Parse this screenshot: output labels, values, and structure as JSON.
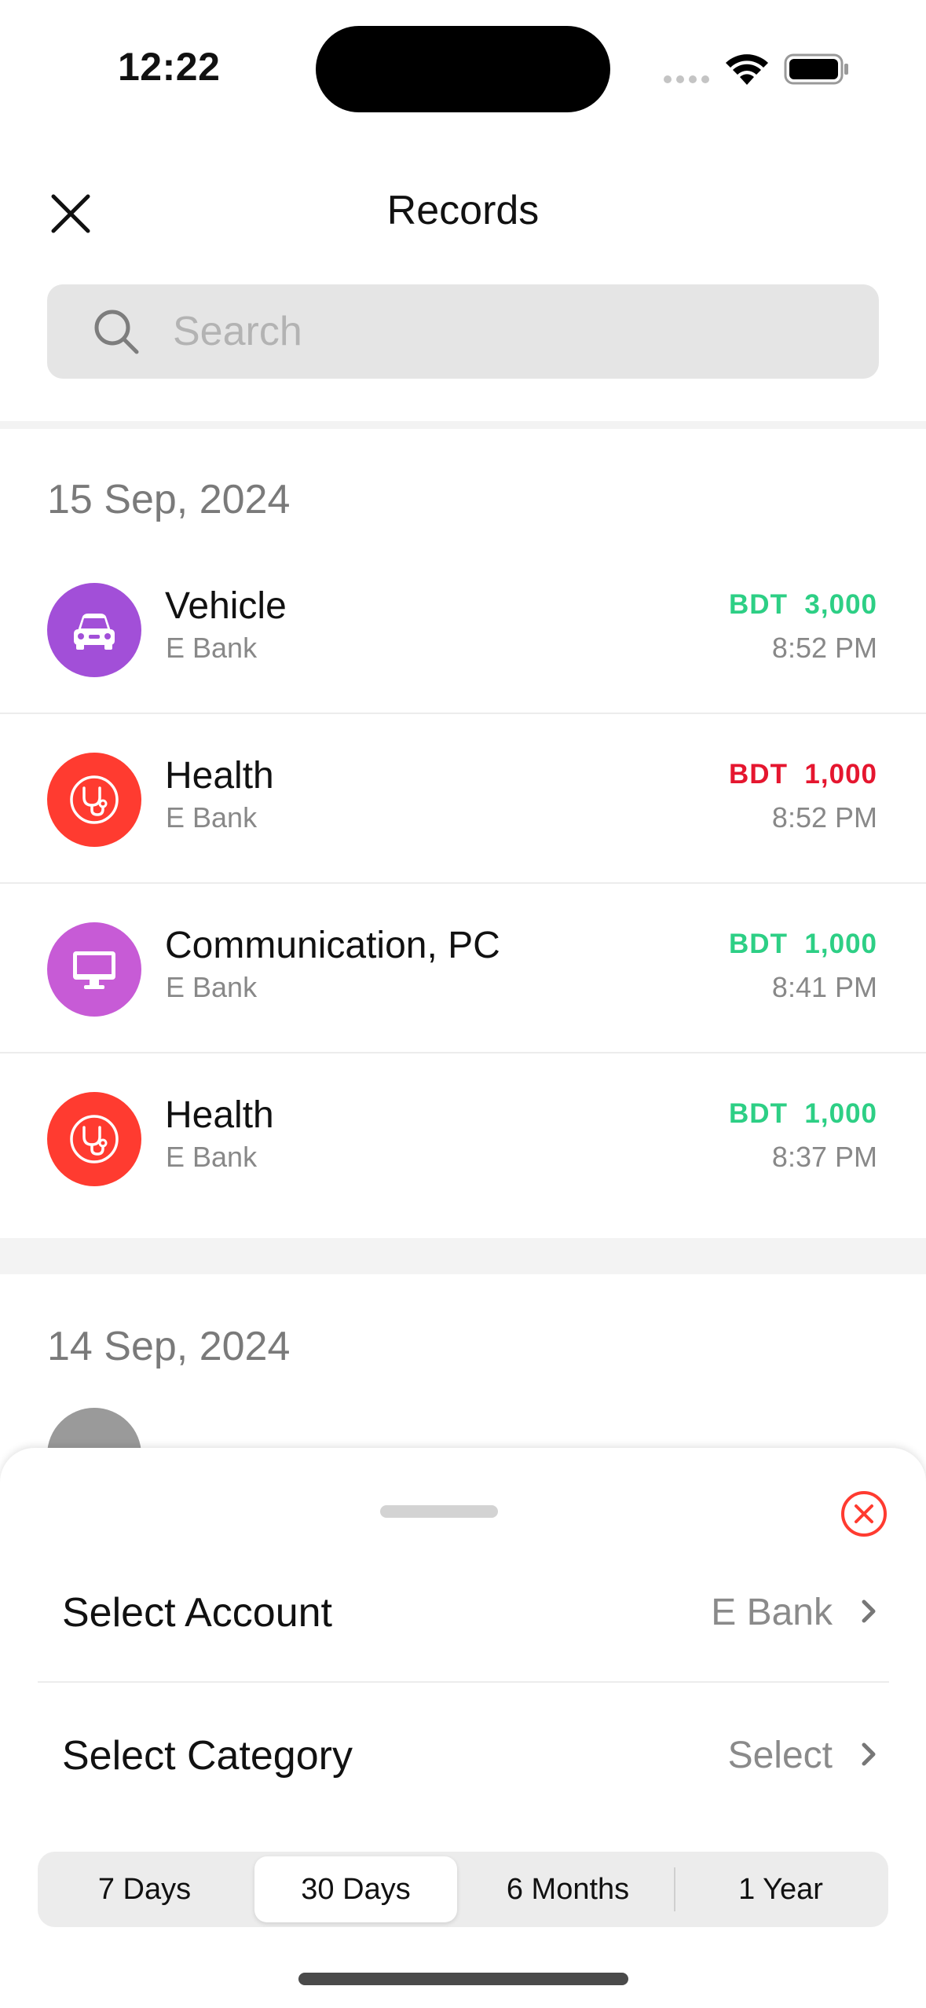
{
  "status_bar": {
    "time": "12:22"
  },
  "header": {
    "title": "Records",
    "close_icon": "close-icon"
  },
  "search": {
    "placeholder": "Search",
    "value": ""
  },
  "sections": [
    {
      "date": "15 Sep, 2024",
      "records": [
        {
          "title": "Vehicle",
          "account": "E Bank",
          "amount": "BDT  3,000",
          "time": "8:52 PM",
          "type": "income",
          "icon": "car-icon",
          "icon_color": "#a24fd8"
        },
        {
          "title": "Health",
          "account": "E Bank",
          "amount": "BDT  1,000",
          "time": "8:52 PM",
          "type": "expense",
          "icon": "stethoscope-icon",
          "icon_color": "#ff3b30"
        },
        {
          "title": "Communication, PC",
          "account": "E Bank",
          "amount": "BDT  1,000",
          "time": "8:41 PM",
          "type": "income",
          "icon": "monitor-icon",
          "icon_color": "#c75bd6"
        },
        {
          "title": "Health",
          "account": "E Bank",
          "amount": "BDT  1,000",
          "time": "8:37 PM",
          "type": "income",
          "icon": "stethoscope-icon",
          "icon_color": "#ff3b30"
        }
      ]
    },
    {
      "date": "14 Sep, 2024",
      "records": []
    }
  ],
  "filter_sheet": {
    "account_label": "Select Account",
    "account_value": "E Bank",
    "category_label": "Select Category",
    "category_value": "Select",
    "periods": [
      "7 Days",
      "30 Days",
      "6 Months",
      "1 Year"
    ],
    "selected_period": "30 Days"
  },
  "colors": {
    "income": "#2dcf85",
    "expense": "#e5162f",
    "accent": "#ff3b30"
  }
}
